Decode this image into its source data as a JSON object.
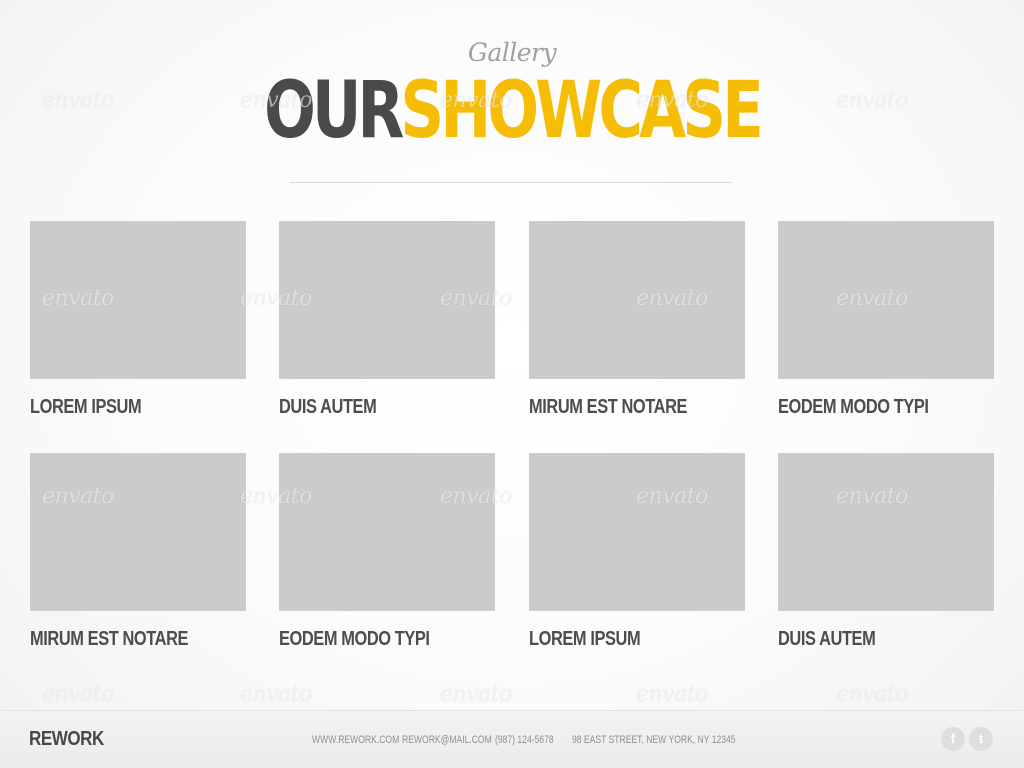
{
  "header": {
    "subtitle": "Gallery",
    "title_dark": "OUR",
    "title_accent": "SHOWCASE"
  },
  "gallery": {
    "items": [
      {
        "caption": "LOREM IPSUM"
      },
      {
        "caption": "DUIS AUTEM"
      },
      {
        "caption": "MIRUM EST NOTARE"
      },
      {
        "caption": "EODEM MODO TYPI"
      },
      {
        "caption": "MIRUM EST NOTARE"
      },
      {
        "caption": "EODEM MODO TYPI"
      },
      {
        "caption": "LOREM IPSUM"
      },
      {
        "caption": "DUIS AUTEM"
      }
    ]
  },
  "footer": {
    "brand": "REWORK",
    "website": "WWW.REWORK.COM",
    "email": "REWORK@MAIL.COM",
    "phone": "(987) 124-5678",
    "address": "98 EAST STREET, NEW YORK, NY 12345",
    "social": [
      {
        "icon": "facebook-icon",
        "glyph": "f"
      },
      {
        "icon": "twitter-icon",
        "glyph": "t"
      }
    ]
  },
  "watermark": "envato",
  "colors": {
    "accent": "#f5bd05",
    "dark_text": "#4a4a4a",
    "placeholder": "#cbcbcb"
  }
}
